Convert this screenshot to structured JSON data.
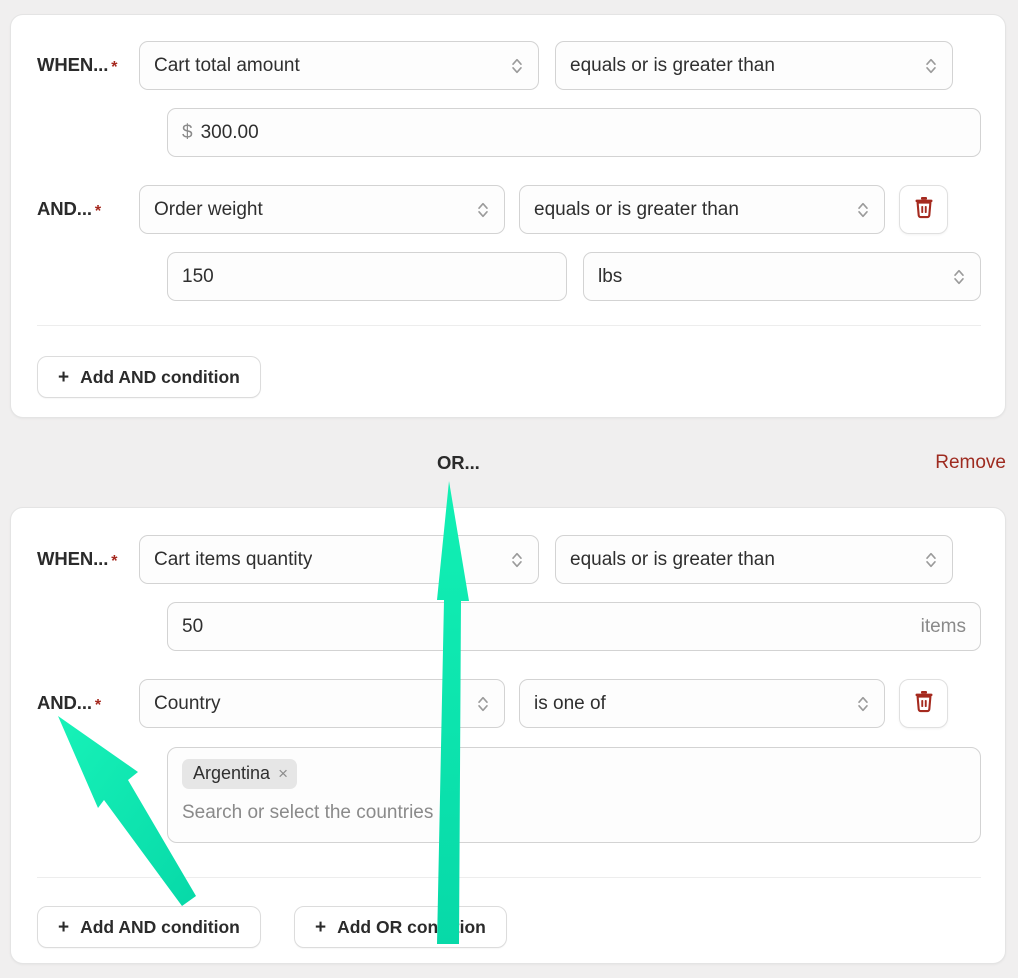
{
  "colors": {
    "page_background": "#f0efef",
    "card_background": "#ffffff",
    "accent_required": "#a5281e",
    "remove_link": "#9e2b20",
    "trash_icon": "#a52a1f",
    "annotation_arrow": "#0fe3ab",
    "chip_background": "#e6e6e6",
    "muted_text": "#8a8a8a"
  },
  "group_1": {
    "when": {
      "label": "WHEN...",
      "required_marker": "*",
      "field_select": "Cart total amount",
      "operator_select": "equals or is greater than",
      "value_prefix": "$",
      "value": "300.00"
    },
    "and": {
      "label": "AND...",
      "required_marker": "*",
      "field_select": "Order weight",
      "operator_select": "equals or is greater than",
      "value": "150",
      "unit_select": "lbs",
      "delete_icon": "trash-icon"
    },
    "add_and_button": {
      "plus": "+",
      "label": "Add AND condition"
    }
  },
  "separator": {
    "or_label": "OR...",
    "remove_label": "Remove"
  },
  "group_2": {
    "when": {
      "label": "WHEN...",
      "required_marker": "*",
      "field_select": "Cart items quantity",
      "operator_select": "equals or is greater than",
      "value": "50",
      "value_suffix": "items"
    },
    "and": {
      "label": "AND...",
      "required_marker": "*",
      "field_select": "Country",
      "operator_select": "is one of",
      "delete_icon": "trash-icon",
      "chips": [
        {
          "label": "Argentina",
          "remove_icon": "close-icon",
          "remove_glyph": "×"
        }
      ],
      "placeholder": "Search or select the countries"
    },
    "add_and_button": {
      "plus": "+",
      "label": "Add AND condition"
    },
    "add_or_button": {
      "plus": "+",
      "label": "Add OR condition"
    }
  },
  "icons": {
    "select_chevron": "chevron-up-down-icon"
  }
}
